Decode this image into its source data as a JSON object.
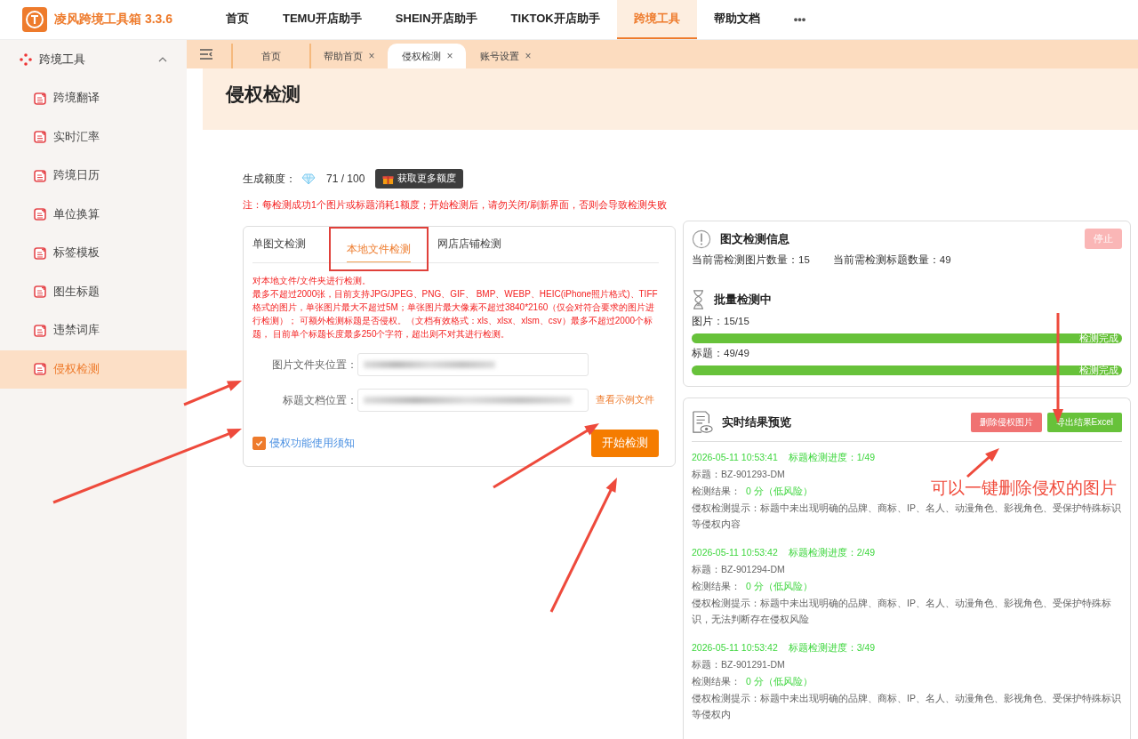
{
  "app": {
    "name": "凌风跨境工具箱 3.3.6"
  },
  "nav": [
    {
      "label": "首页",
      "selected": false
    },
    {
      "label": "TEMU开店助手",
      "selected": false
    },
    {
      "label": "SHEIN开店助手",
      "selected": false
    },
    {
      "label": "TIKTOK开店助手",
      "selected": false
    },
    {
      "label": "跨境工具",
      "selected": true
    },
    {
      "label": "帮助文档",
      "selected": false
    }
  ],
  "nav_more": "•••",
  "sidebar": {
    "group": {
      "label": "跨境工具",
      "expanded": true
    },
    "items": [
      {
        "label": "跨境翻译",
        "selected": false
      },
      {
        "label": "实时汇率",
        "selected": false
      },
      {
        "label": "跨境日历",
        "selected": false
      },
      {
        "label": "单位换算",
        "selected": false
      },
      {
        "label": "标签模板",
        "selected": false
      },
      {
        "label": "图生标题",
        "selected": false
      },
      {
        "label": "违禁词库",
        "selected": false
      },
      {
        "label": "侵权检测",
        "selected": true
      }
    ]
  },
  "tabs": [
    {
      "label": "首页",
      "selected": false,
      "closable": false
    },
    {
      "label": "帮助首页",
      "selected": false,
      "closable": true
    },
    {
      "label": "侵权检测",
      "selected": true,
      "closable": true
    },
    {
      "label": "账号设置",
      "selected": false,
      "closable": true
    }
  ],
  "tab_close": "×",
  "page_title": "侵权检测",
  "quota": {
    "label": "生成额度：",
    "value": "71 / 100",
    "button": "获取更多额度"
  },
  "notice": "注：每检测成功1个图片或标题消耗1额度；开始检测后，请勿关闭/刷新界面，否则会导致检测失败",
  "detect_card": {
    "tabs": [
      {
        "label": "单图文检测",
        "selected": false
      },
      {
        "label": "本地文件检测",
        "selected": true
      },
      {
        "label": "网店店铺检测",
        "selected": false
      }
    ],
    "description": [
      "对本地文件/文件夹进行检测。",
      "最多不超过2000张，目前支持JPG/JPEG、PNG、GIF、 BMP、WEBP、HEIC(iPhone照片格式)、TIFF格式的图片，单张图片最大不超过5M；单张图片最大像素不超过3840*2160（仅会对符合要求的图片进行检测）； 可额外检测标题是否侵权。（文档有效格式：xls、xlsx、xlsm、csv）最多不超过2000个标题， 目前单个标题长度最多250个字符，超出则不对其进行检测。"
    ],
    "fields": [
      {
        "label": "图片文件夹位置：",
        "value_blurred": true
      },
      {
        "label": "标题文档位置：",
        "value_blurred": true,
        "link": "查看示例文件"
      }
    ],
    "agree": {
      "label": "侵权功能使用须知",
      "checked": true
    },
    "start_button": "开始检测"
  },
  "info_card": {
    "title": "图文检测信息",
    "stop_button": {
      "label": "停止",
      "disabled": true
    },
    "counts": [
      "当前需检测图片数量：15",
      "当前需检测标题数量：49"
    ],
    "batch_title": "批量检测中",
    "bars": [
      {
        "label": "图片：15/15",
        "level": 1,
        "status": "检测完成"
      },
      {
        "label": "标题：49/49",
        "level": 1,
        "status": "检测完成"
      }
    ]
  },
  "results": {
    "title": "实时结果预览",
    "buttons": [
      {
        "label": "删除侵权图片",
        "kind": "danger"
      },
      {
        "label": "导出结果Excel",
        "kind": "success"
      }
    ],
    "entries": [
      {
        "time": "2026-05-11 10:53:41",
        "progress": "标题检测进度：1/49",
        "title": "标题：BZ-901293-DM",
        "result_label": "检测结果：",
        "result": "0 分（低风险）",
        "hint": "侵权检测提示：标题中未出现明确的品牌、商标、IP、名人、动漫角色、影视角色、受保护特殊标识等侵权内容"
      },
      {
        "time": "2026-05-11 10:53:42",
        "progress": "标题检测进度：2/49",
        "title": "标题：BZ-901294-DM",
        "result_label": "检测结果：",
        "result": "0 分（低风险）",
        "hint": "侵权检测提示：标题中未出现明确的品牌、商标、IP、名人、动漫角色、影视角色、受保护特殊标识，无法判断存在侵权风险"
      },
      {
        "time": "2026-05-11 10:53:42",
        "progress": "标题检测进度：3/49",
        "title": "标题：BZ-901291-DM",
        "result_label": "检测结果：",
        "result": "0 分（低风险）",
        "hint": "侵权检测提示：标题中未出现明确的品牌、商标、IP、名人、动漫角色、影视角色、受保护特殊标识等侵权内"
      }
    ]
  },
  "annotation": {
    "text": "可以一键删除侵权的图片"
  }
}
